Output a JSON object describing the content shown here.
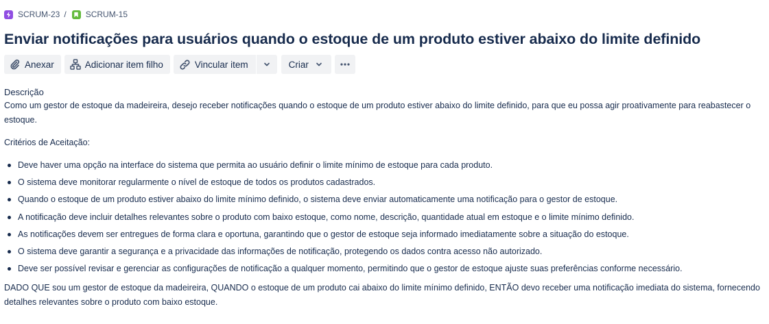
{
  "breadcrumb": {
    "parent": {
      "key": "SCRUM-23",
      "icon": "epic-icon",
      "color": "#904ee2"
    },
    "separator": "/",
    "current": {
      "key": "SCRUM-15",
      "icon": "story-icon",
      "color": "#63ba3c"
    }
  },
  "issue": {
    "title": "Enviar notificações para usuários quando o estoque de um produto estiver abaixo do limite definido"
  },
  "toolbar": {
    "attach_label": "Anexar",
    "add_child_label": "Adicionar item filho",
    "link_label": "Vincular item",
    "create_label": "Criar"
  },
  "description": {
    "heading": "Descrição",
    "intro": "Como um gestor de estoque da madeireira, desejo receber notificações quando o estoque de um produto estiver abaixo do limite definido, para que eu possa agir proativamente para reabastecer o estoque.",
    "criteria_heading": "Critérios de Aceitação:",
    "criteria": [
      "Deve haver uma opção na interface do sistema que permita ao usuário definir o limite mínimo de estoque para cada produto.",
      "O sistema deve monitorar regularmente o nível de estoque de todos os produtos cadastrados.",
      "Quando o estoque de um produto estiver abaixo do limite mínimo definido, o sistema deve enviar automaticamente uma notificação para o gestor de estoque.",
      "A notificação deve incluir detalhes relevantes sobre o produto com baixo estoque, como nome, descrição, quantidade atual em estoque e o limite mínimo definido.",
      "As notificações devem ser entregues de forma clara e oportuna, garantindo que o gestor de estoque seja informado imediatamente sobre a situação do estoque.",
      "O sistema deve garantir a segurança e a privacidade das informações de notificação, protegendo os dados contra acesso não autorizado.",
      "Deve ser possível revisar e gerenciar as configurações de notificação a qualquer momento, permitindo que o gestor de estoque ajuste suas preferências conforme necessário."
    ],
    "scenario": "DADO QUE sou um gestor de estoque da madeireira, QUANDO o estoque de um produto cai abaixo do limite mínimo definido, ENTÃO devo receber uma notificação imediata do sistema, fornecendo detalhes relevantes sobre o produto com baixo estoque."
  }
}
